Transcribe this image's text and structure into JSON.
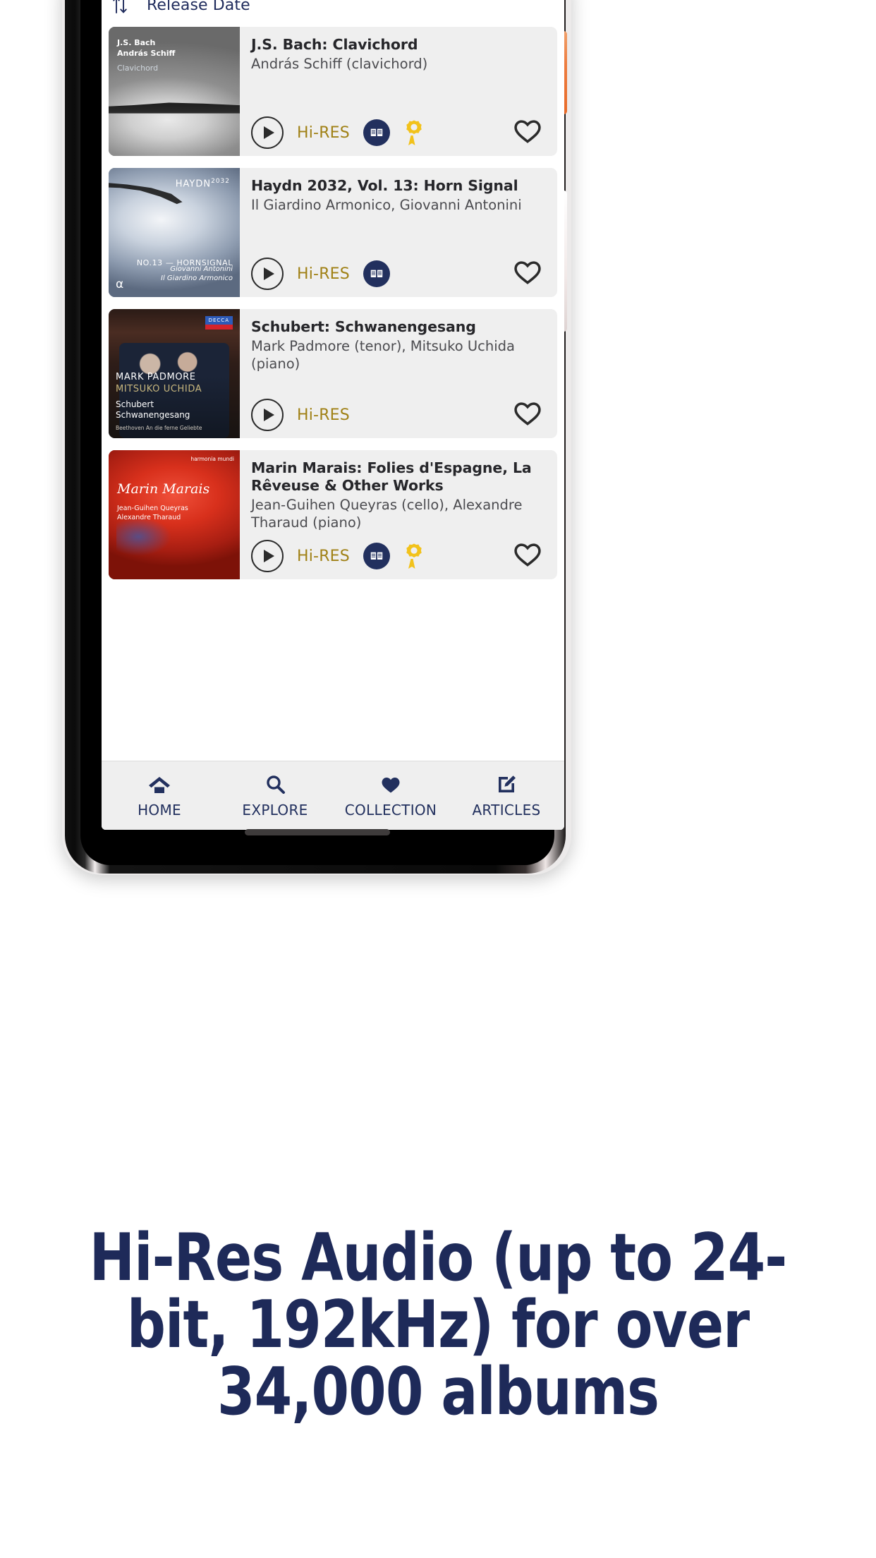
{
  "app": {
    "sort": {
      "icon": "sort-arrows-icon",
      "label": "Release Date"
    },
    "albums": [
      {
        "title": "J.S. Bach: Clavichord",
        "artist": "András Schiff (clavichord)",
        "cover_text": {
          "line1": "J.S. Bach",
          "line2": "András Schiff",
          "line3": "Clavichord"
        },
        "quality_badge": "Hi-RES",
        "has_booklet": true,
        "has_award": true,
        "favourite": false
      },
      {
        "title": "Haydn 2032, Vol. 13: Horn Signal",
        "artist": "Il Giardino Armonico, Giovanni Antonini",
        "cover_text": {
          "line1": "HAYDN",
          "line2": "2032",
          "line3": "NO.13 — HORNSIGNAL",
          "line4": "Giovanni Antonini",
          "line5": "Il Giardino Armonico",
          "line6": "α"
        },
        "quality_badge": "Hi-RES",
        "has_booklet": true,
        "has_award": false,
        "favourite": false
      },
      {
        "title": "Schubert: Schwanengesang",
        "artist": "Mark Padmore (tenor), Mitsuko Uchida (piano)",
        "cover_text": {
          "line1": "DECCA",
          "line2": "MARK PADMORE",
          "line3": "MITSUKO UCHIDA",
          "line4": "Schubert",
          "line5": "Schwanengesang",
          "line6": "Beethoven An die ferne Geliebte"
        },
        "quality_badge": "Hi-RES",
        "has_booklet": false,
        "has_award": false,
        "favourite": false
      },
      {
        "title": "Marin Marais: Folies d'Espagne, La Rêveuse & Other Works",
        "artist": "Jean-Guihen Queyras (cello), Alexandre Tharaud (piano)",
        "cover_text": {
          "line1": "harmonia mundi",
          "line2": "Marin Marais",
          "line3": "Jean-Guihen Queyras",
          "line4": "Alexandre Tharaud"
        },
        "quality_badge": "Hi-RES",
        "has_booklet": true,
        "has_award": true,
        "favourite": false
      }
    ],
    "bottom_nav": [
      {
        "label": "HOME",
        "icon": "home-icon"
      },
      {
        "label": "EXPLORE",
        "icon": "search-icon"
      },
      {
        "label": "COLLECTION",
        "icon": "heart-filled-icon"
      },
      {
        "label": "ARTICLES",
        "icon": "edit-square-icon"
      }
    ]
  },
  "promo": {
    "headline": "Hi-Res Audio (up to 24-bit, 192kHz) for over 34,000 albums"
  },
  "colors": {
    "navy": "#22305e",
    "headline_navy": "#1e2a59",
    "gold": "#a08116",
    "award_gold": "#f2c21b",
    "card_bg": "#efefef",
    "power_button": "#ed7c3f"
  }
}
